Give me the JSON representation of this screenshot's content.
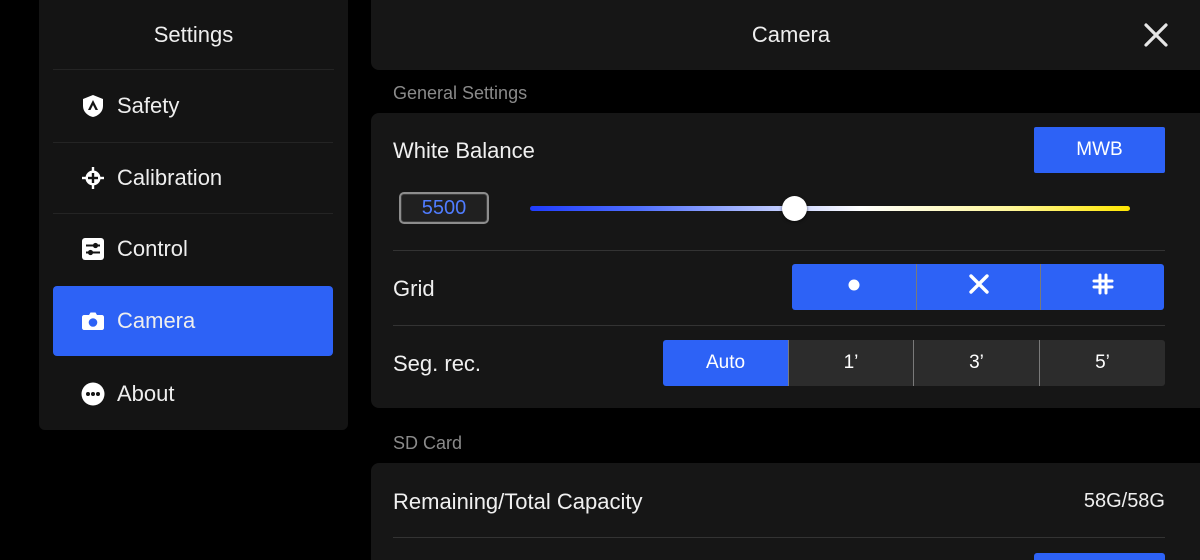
{
  "sidebar": {
    "title": "Settings",
    "items": [
      {
        "label": "Safety",
        "icon": "shield-icon"
      },
      {
        "label": "Calibration",
        "icon": "calibration-icon"
      },
      {
        "label": "Control",
        "icon": "sliders-icon"
      },
      {
        "label": "Camera",
        "icon": "camera-icon",
        "active": true
      },
      {
        "label": "About",
        "icon": "more-icon"
      }
    ]
  },
  "header": {
    "title": "Camera",
    "close_icon": "close-icon"
  },
  "general": {
    "section_label": "General Settings",
    "white_balance": {
      "label": "White Balance",
      "mode_button": "MWB",
      "value": "5500",
      "slider_fraction": 0.44
    },
    "grid": {
      "label": "Grid",
      "options": [
        {
          "icon": "center-dot-icon"
        },
        {
          "icon": "diagonal-cross-icon"
        },
        {
          "icon": "grid-hash-icon"
        }
      ]
    },
    "seg_rec": {
      "label": "Seg. rec.",
      "options": [
        "Auto",
        "1’",
        "3’",
        "5’"
      ],
      "selected": "Auto"
    }
  },
  "sd_card": {
    "section_label": "SD Card",
    "capacity_label": "Remaining/Total Capacity",
    "capacity_value": "58G/58G"
  },
  "colors": {
    "accent": "#2d62f6",
    "panel": "#161616",
    "background": "#000000"
  }
}
